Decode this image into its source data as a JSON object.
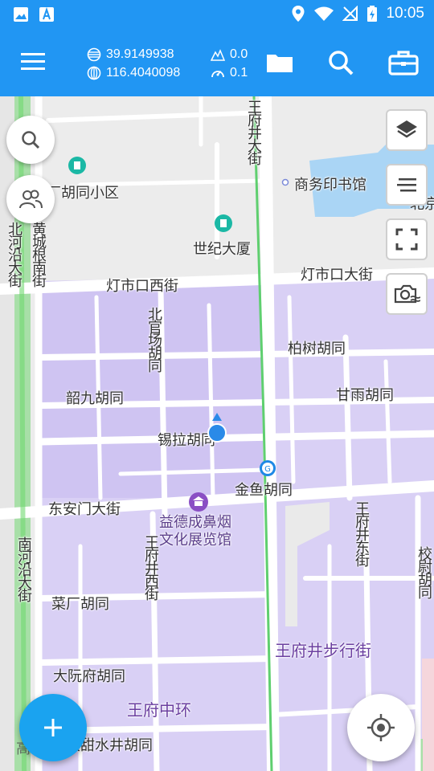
{
  "status_bar": {
    "time": "10:05"
  },
  "header": {
    "latitude": "39.9149938",
    "longitude": "116.4040098",
    "altitude": "0.0",
    "speed": "0.1"
  },
  "map": {
    "streets": {
      "wangfujing_st": "王府井大街",
      "dengshikou_xi": "灯市口西街",
      "dengshikou_st": "灯市口大街",
      "huangchenggen": "黄城根南街",
      "beiheyan": "北河沿大街",
      "beiguanchang": "北官场胡同",
      "baishu": "柏树胡同",
      "shaojiu": "韶九胡同",
      "ganyu": "甘雨胡同",
      "xila": "锡拉胡同",
      "jinyu": "金鱼胡同",
      "donganmen": "东安门大街",
      "nanheyan": "南河沿大街",
      "wangfujing_xi": "王府井西街",
      "wangfujing_dong": "王府井东街",
      "xiaowei": "校尉胡同",
      "caichang": "菜厂胡同",
      "dayuanfu": "大阮府胡同",
      "datianshuijing": "大甜水井胡同"
    },
    "pois": {
      "community": "厂胡同小区",
      "shiji": "世纪大厦",
      "commercial_press": "商务印书馆",
      "museum": "益德成鼻烟文化展览馆",
      "pedestrian": "王府井步行街",
      "wangfu_central": "王府中环",
      "partial_right": "北京"
    },
    "watermark": "高德地图"
  }
}
